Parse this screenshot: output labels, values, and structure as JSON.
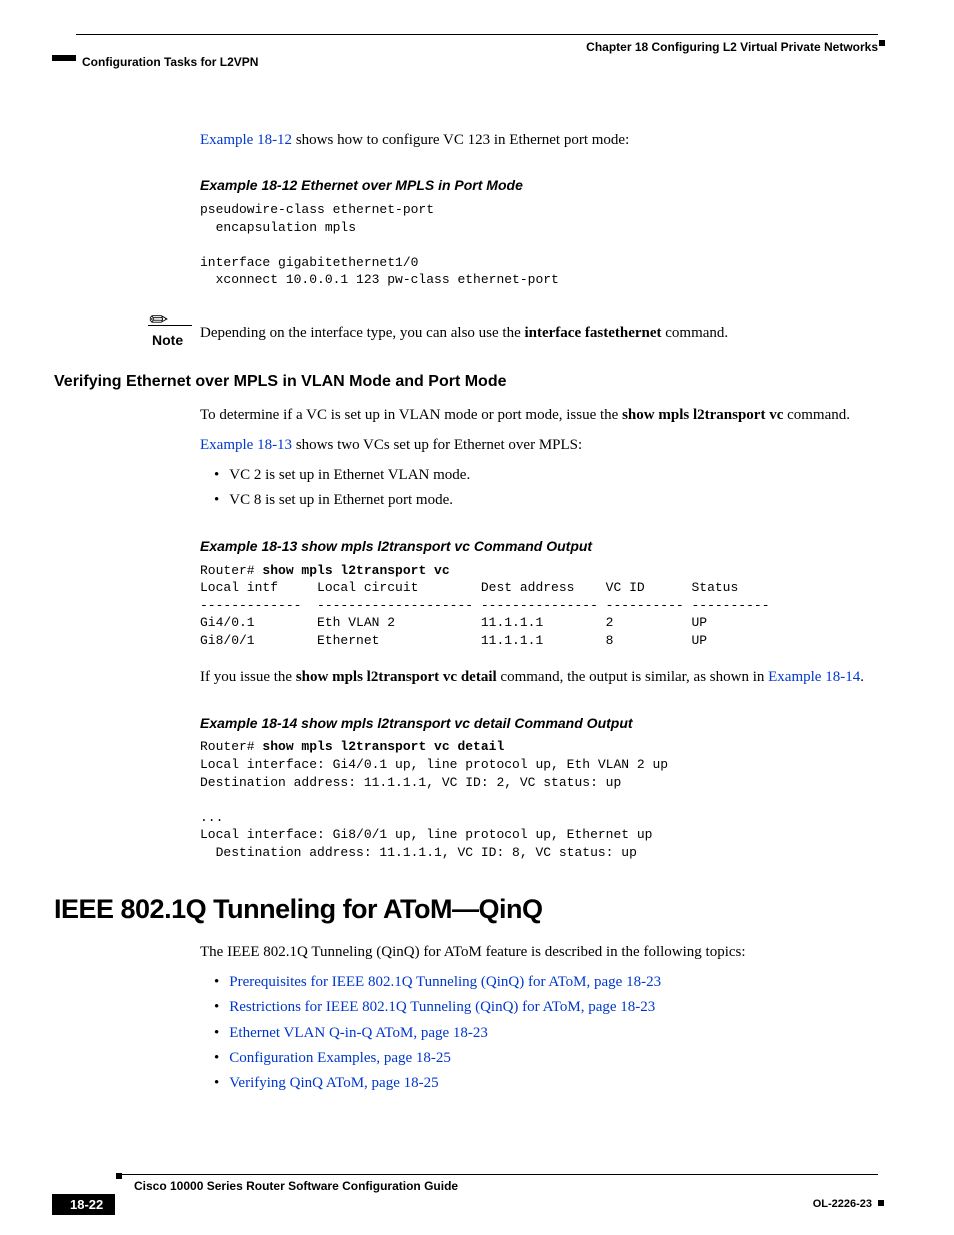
{
  "header": {
    "chapter": "Chapter 18    Configuring L2 Virtual Private Networks",
    "section": "Configuration Tasks for L2VPN"
  },
  "intro": {
    "link": "Example 18-12",
    "rest": " shows how to configure VC 123 in Ethernet port mode:"
  },
  "example12": {
    "title": "Example 18-12 Ethernet over MPLS in Port Mode",
    "code": "pseudowire-class ethernet-port\n  encapsulation mpls\n\ninterface gigabitethernet1/0\n  xconnect 10.0.0.1 123 pw-class ethernet-port"
  },
  "note": {
    "label": "Note",
    "pre": "Depending on the interface type, you can also use the ",
    "bold": "interface fastethernet",
    "post": " command."
  },
  "verify_heading": "Verifying Ethernet over MPLS in VLAN Mode and Port Mode",
  "verify_p1_pre": "To determine if a VC is set up in VLAN mode or port mode, issue the ",
  "verify_p1_bold": "show mpls l2transport vc",
  "verify_p1_post": " command.",
  "verify_p2_link": "Example 18-13",
  "verify_p2_rest": " shows two VCs set up for Ethernet over MPLS:",
  "verify_bullets": [
    "VC 2 is set up in Ethernet VLAN mode.",
    "VC 8 is set up in Ethernet port mode."
  ],
  "example13": {
    "title": "Example 18-13 show mpls l2transport vc Command Output",
    "prompt": "Router# ",
    "cmd": "show mpls l2transport vc",
    "output": "\nLocal intf     Local circuit        Dest address    VC ID      Status\n-------------  -------------------- --------------- ---------- ----------\nGi4/0.1        Eth VLAN 2           11.1.1.1        2          UP\nGi8/0/1        Ethernet             11.1.1.1        8          UP"
  },
  "verify_p3_pre": "If you issue the ",
  "verify_p3_bold": "show mpls l2transport vc detail",
  "verify_p3_mid": " command, the output is similar, as shown in ",
  "verify_p3_link": "Example 18-14",
  "verify_p3_post": ".",
  "example14": {
    "title": "Example 18-14 show mpls l2transport vc detail Command Output",
    "prompt": "Router# ",
    "cmd": "show mpls l2transport vc detail",
    "output": "\nLocal interface: Gi4/0.1 up, line protocol up, Eth VLAN 2 up\nDestination address: 11.1.1.1, VC ID: 2, VC status: up\n\n...\nLocal interface: Gi8/0/1 up, line protocol up, Ethernet up\n  Destination address: 11.1.1.1, VC ID: 8, VC status: up"
  },
  "h2": "IEEE 802.1Q Tunneling for AToM—QinQ",
  "qinq_intro": "The IEEE 802.1Q Tunneling (QinQ) for AToM feature is described in the following topics:",
  "qinq_links": [
    "Prerequisites for IEEE 802.1Q Tunneling (QinQ) for AToM, page 18-23",
    "Restrictions for IEEE 802.1Q Tunneling (QinQ) for AToM, page 18-23",
    "Ethernet VLAN Q-in-Q AToM, page 18-23",
    "Configuration Examples, page 18-25",
    "Verifying QinQ AToM, page 18-25"
  ],
  "footer": {
    "title": "Cisco 10000 Series Router Software Configuration Guide",
    "page": "18-22",
    "docid": "OL-2226-23"
  }
}
